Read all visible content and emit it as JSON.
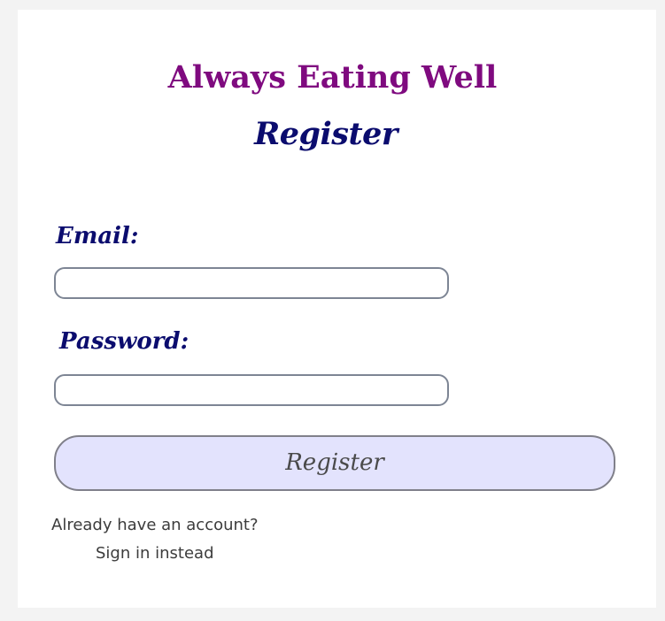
{
  "app": {
    "title": "Always Eating Well"
  },
  "page": {
    "heading": "Register"
  },
  "form": {
    "email": {
      "label": "Email:",
      "value": "",
      "placeholder": ""
    },
    "password": {
      "label": "Password:",
      "value": "",
      "placeholder": ""
    },
    "submit_label": "Register"
  },
  "footer": {
    "prompt": "Already have an account?",
    "signin_link": "Sign in instead"
  },
  "colors": {
    "page_background": "#f3f3f3",
    "card_background": "#ffffff",
    "app_title": "#7f0a7f",
    "heading": "#0b0c6e",
    "button_background": "#e3e3fd",
    "input_border": "#7d8594"
  }
}
